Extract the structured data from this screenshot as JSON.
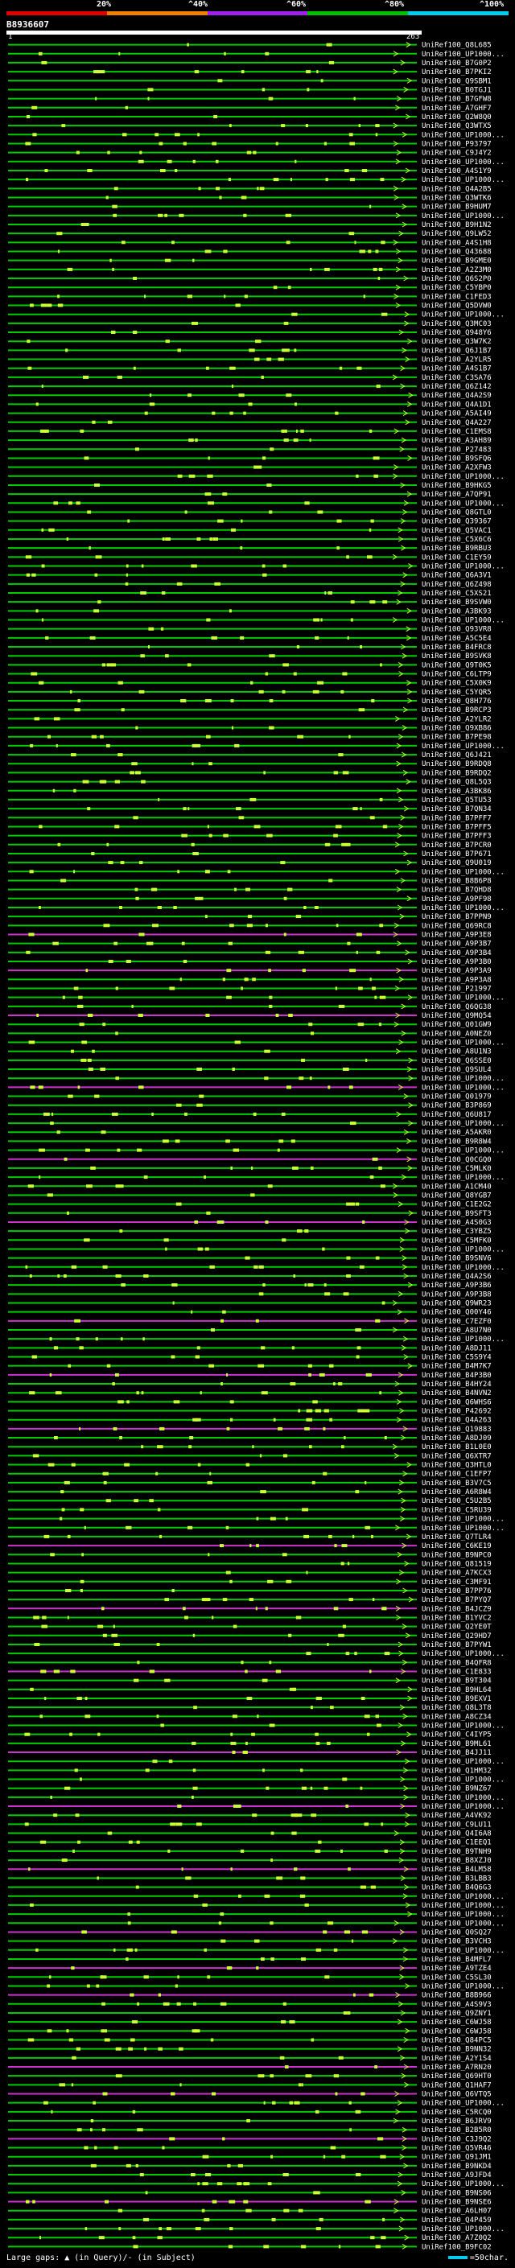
{
  "identity_scale": {
    "labels": [
      "20%",
      "^40%",
      "^60%",
      "^80%",
      "^100%"
    ],
    "colors": [
      "#e00000",
      "#f08000",
      "#a020f0",
      "#00c000",
      "#00ccee"
    ]
  },
  "query": {
    "id": "B8936607",
    "start": "1",
    "end": "263"
  },
  "hit_colors": {
    "green": "#00cc00",
    "magenta": "#cc33cc",
    "highlight": "#ccff33",
    "arrow": "#ccff33"
  },
  "hits": [
    "UniRef100_Q8L685",
    "UniRef100_UP1000...",
    "UniRef100_B7G0P2",
    "UniRef100_B7PKI2",
    "UniRef100_Q9SBM1",
    "UniRef100_B0TGJ1",
    "UniRef100_B7GFW8",
    "UniRef100_A7GHF7",
    "UniRef100_Q2W8Q0",
    "UniRef100_Q3WTX5",
    "UniRef100_UP1000...",
    "UniRef100_P93797",
    "UniRef100_C9J4Y2",
    "UniRef100_UP1000...",
    "UniRef100_A4S1Y9",
    "UniRef100_UP1000...",
    "UniRef100_Q4A2B5",
    "UniRef100_Q3WTK6",
    "UniRef100_B9HUM7",
    "UniRef100_UP1000...",
    "UniRef100_B9H1N2",
    "UniRef100_Q9LW52",
    "UniRef100_A4S1H8",
    "UniRef100_Q43688",
    "UniRef100_B9GME0",
    "UniRef100_A2Z3M0",
    "UniRef100_Q6S2P0",
    "UniRef100_C5YBP0",
    "UniRef100_C1FED3",
    "UniRef100_Q5DVW0",
    "UniRef100_UP1000...",
    "UniRef100_Q3MC03",
    "UniRef100_Q948Y6",
    "UniRef100_Q3W7K2",
    "UniRef100_Q6J1B7",
    "UniRef100_A2YLR5",
    "UniRef100_A4S1B7",
    "UniRef100_C3SA76",
    "UniRef100_Q6Z142",
    "UniRef100_Q4A2S9",
    "UniRef100_Q4A1D1",
    "UniRef100_A5AI49",
    "UniRef100_Q4A227",
    "UniRef100_C1EMS8",
    "UniRef100_A3AH89",
    "UniRef100_P27483",
    "UniRef100_B9SFQ6",
    "UniRef100_A2XFW3",
    "UniRef100_UP1000...",
    "UniRef100_B9HKG5",
    "UniRef100_A7QP91",
    "UniRef100_UP1000...",
    "UniRef100_Q8GTL0",
    "UniRef100_Q39367",
    "UniRef100_Q5VAC1",
    "UniRef100_C5X6C6",
    "UniRef100_B9RBU3",
    "UniRef100_C1EY59",
    "UniRef100_UP1000...",
    "UniRef100_Q6A3V1",
    "UniRef100_Q6Z498",
    "UniRef100_C5XS21",
    "UniRef100_B9SVW0",
    "UniRef100_A3BK93",
    "UniRef100_UP1000...",
    "UniRef100_Q93VR8",
    "UniRef100_A5C5E4",
    "UniRef100_B4FRC8",
    "UniRef100_B9SVK8",
    "UniRef100_Q9T0K5",
    "UniRef100_C6LTP9",
    "UniRef100_C5X0K9",
    "UniRef100_C5YQR5",
    "UniRef100_Q8H776",
    "UniRef100_B9RCP3",
    "UniRef100_A2YLR2",
    "UniRef100_Q9XB86",
    "UniRef100_B7PE98",
    "UniRef100_UP1000...",
    "UniRef100_Q6J421",
    "UniRef100_B9RDQ8",
    "UniRef100_B9RDQ2",
    "UniRef100_Q8L5Q3",
    "UniRef100_A3BK86",
    "UniRef100_Q5TU53",
    "UniRef100_B7QN34",
    "UniRef100_B7PFF7",
    "UniRef100_B7PFF5",
    "UniRef100_B7PFF3",
    "UniRef100_B7PCR0",
    "UniRef100_B7P671",
    "UniRef100_Q9U019",
    "UniRef100_UP1000...",
    "UniRef100_B8B6P8",
    "UniRef100_B7QHD8",
    "UniRef100_A9PF98",
    "UniRef100_UP1000...",
    "UniRef100_B7PPN9",
    "UniRef100_Q69RC8",
    "UniRef100_A9P3E8",
    "UniRef100_A9P3B7",
    "UniRef100_A9P3B4",
    "UniRef100_A9P3B0",
    "UniRef100_A9P3A9",
    "UniRef100_A9P3A8",
    "UniRef100_P21997",
    "UniRef100_UP1000...",
    "UniRef100_Q6QG38",
    "UniRef100_Q9MQ54",
    "UniRef100_Q01GW9",
    "UniRef100_A0NEZ0",
    "UniRef100_UP1000...",
    "UniRef100_A8U1N3",
    "UniRef100_Q6SSE0",
    "UniRef100_Q9SUL4",
    "UniRef100_UP1000...",
    "UniRef100_UP1000...",
    "UniRef100_Q01979",
    "UniRef100_B3P869",
    "UniRef100_Q6U817",
    "UniRef100_UP1000...",
    "UniRef100_A5AKR0",
    "UniRef100_B9R8W4",
    "UniRef100_UP1000...",
    "UniRef100_Q0CGQ0",
    "UniRef100_C5MLK0",
    "UniRef100_UP1000...",
    "UniRef100_A1CM40",
    "UniRef100_Q8YGB7",
    "UniRef100_C1E2G2",
    "UniRef100_B9SFT3",
    "UniRef100_A4S0G3",
    "UniRef100_C3YBZ5",
    "UniRef100_C5MFK0",
    "UniRef100_UP1000...",
    "UniRef100_B9SNV6",
    "UniRef100_UP1000...",
    "UniRef100_Q4A2S6",
    "UniRef100_A9P3B6",
    "UniRef100_A9P3B8",
    "UniRef100_Q9WR23",
    "UniRef100_Q00Y46",
    "UniRef100_C7EZF0",
    "UniRef100_A8U7N0",
    "UniRef100_UP1000...",
    "UniRef100_A8DJ11",
    "UniRef100_C5S9Y4",
    "UniRef100_B4M7K7",
    "UniRef100_B4P3B0",
    "UniRef100_B4HY24",
    "UniRef100_B4NVN2",
    "UniRef100_Q6WHS6",
    "UniRef100_P42692",
    "UniRef100_Q4A263",
    "UniRef100_Q19883",
    "UniRef100_A8DJ09",
    "UniRef100_B1L0E0",
    "UniRef100_Q6XTR7",
    "UniRef100_Q3HTL0",
    "UniRef100_C1EFP7",
    "UniRef100_B3V7C5",
    "UniRef100_A6R8W4",
    "UniRef100_C5U2B5",
    "UniRef100_C5RU39",
    "UniRef100_UP1000...",
    "UniRef100_UP1000...",
    "UniRef100_Q7TLR4",
    "UniRef100_C6KE19",
    "UniRef100_B9NPC0",
    "UniRef100_Q81519",
    "UniRef100_A7KCX3",
    "UniRef100_C3MF91",
    "UniRef100_B7PP76",
    "UniRef100_B7PYQ7",
    "UniRef100_B4JCZ9",
    "UniRef100_B1YVC2",
    "UniRef100_Q2YE0T",
    "UniRef100_Q29HD7",
    "UniRef100_B7PYW1",
    "UniRef100_UP1000...",
    "UniRef100_B4QFR8",
    "UniRef100_C1E833",
    "UniRef100_B9T304",
    "UniRef100_B9HL64",
    "UniRef100_B9EXV1",
    "UniRef100_Q8L3T8",
    "UniRef100_A8CZ34",
    "UniRef100_UP1000...",
    "UniRef100_C4IYP5",
    "UniRef100_B9ML61",
    "UniRef100_B4JJ11",
    "UniRef100_UP1000...",
    "UniRef100_Q1HM32",
    "UniRef100_UP1000...",
    "UniRef100_B9NZ67",
    "UniRef100_UP1000...",
    "UniRef100_UP1000...",
    "UniRef100_A4VK92",
    "UniRef100_C9LU11",
    "UniRef100_Q4I6A8",
    "UniRef100_C1EEQ1",
    "UniRef100_B9TNH9",
    "UniRef100_B8XZJ0",
    "UniRef100_B4LM58",
    "UniRef100_B3LBB3",
    "UniRef100_B4Q6G3",
    "UniRef100_UP1000...",
    "UniRef100_UP1000...",
    "UniRef100_UP1000...",
    "UniRef100_UP1000...",
    "UniRef100_Q0SQ27",
    "UniRef100_B3VCH3",
    "UniRef100_UP1000...",
    "UniRef100_B4MFL7",
    "UniRef100_A9TZE4",
    "UniRef100_C5SL30",
    "UniRef100_UP1000...",
    "UniRef100_B8B966",
    "UniRef100_A4S9V3",
    "UniRef100_Q9ZNY1",
    "UniRef100_C6WJ58",
    "UniRef100_C6WJ58",
    "UniRef100_Q84PC5",
    "UniRef100_B9NN32",
    "UniRef100_A2Y1S4",
    "UniRef100_A7RN20",
    "UniRef100_Q69HT0",
    "UniRef100_Q1HAF7",
    "UniRef100_Q6VTQ5",
    "UniRef100_UP1000...",
    "UniRef100_C5RCQ0",
    "UniRef100_B6JRV9",
    "UniRef100_B2B5R0",
    "UniRef100_C3J9Q2",
    "UniRef100_Q5VR46",
    "UniRef100_Q91JM1",
    "UniRef100_B9NKD4",
    "UniRef100_A9JFD4",
    "UniRef100_UP1000...",
    "UniRef100_B9NS06",
    "UniRef100_B9NSE6",
    "UniRef100_A6LH07",
    "UniRef100_Q4P459",
    "UniRef100_UP1000...",
    "UniRef100_A7Z0Q2",
    "UniRef100_B9FC02"
  ],
  "footer": {
    "text": "Large gaps: ▲ (in Query)/- (in Subject)",
    "scale": "=50char."
  }
}
